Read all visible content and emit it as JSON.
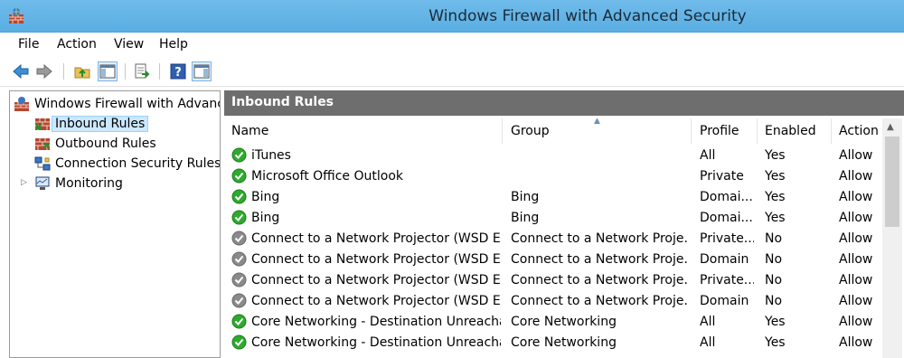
{
  "window": {
    "title": "Windows Firewall with Advanced Security"
  },
  "menu": [
    "File",
    "Action",
    "View",
    "Help"
  ],
  "toolbar": {
    "buttons": [
      "back-arrow-icon",
      "forward-arrow-icon",
      "up-folder-icon",
      "show-hide-tree-icon",
      "export-list-icon",
      "help-icon",
      "show-hide-action-pane-icon"
    ]
  },
  "tree": {
    "root": "Windows Firewall with Advance",
    "items": [
      "Inbound Rules",
      "Outbound Rules",
      "Connection Security Rules",
      "Monitoring"
    ],
    "selected": "Inbound Rules"
  },
  "pane": {
    "title": "Inbound Rules"
  },
  "table": {
    "columns": [
      "Name",
      "Group",
      "Profile",
      "Enabled",
      "Action"
    ],
    "rows": [
      {
        "status": "enabled",
        "name": "iTunes",
        "group": "",
        "profile": "All",
        "enabled": "Yes",
        "action": "Allow"
      },
      {
        "status": "enabled",
        "name": "Microsoft Office Outlook",
        "group": "",
        "profile": "Private",
        "enabled": "Yes",
        "action": "Allow"
      },
      {
        "status": "enabled",
        "name": "Bing",
        "group": "Bing",
        "profile": "Domai...",
        "enabled": "Yes",
        "action": "Allow"
      },
      {
        "status": "enabled",
        "name": "Bing",
        "group": "Bing",
        "profile": "Domai...",
        "enabled": "Yes",
        "action": "Allow"
      },
      {
        "status": "disabled",
        "name": "Connect to a Network Projector (WSD Ev...",
        "group": "Connect to a Network Proje...",
        "profile": "Private...",
        "enabled": "No",
        "action": "Allow"
      },
      {
        "status": "disabled",
        "name": "Connect to a Network Projector (WSD Ev...",
        "group": "Connect to a Network Proje...",
        "profile": "Domain",
        "enabled": "No",
        "action": "Allow"
      },
      {
        "status": "disabled",
        "name": "Connect to a Network Projector (WSD Ev...",
        "group": "Connect to a Network Proje...",
        "profile": "Private...",
        "enabled": "No",
        "action": "Allow"
      },
      {
        "status": "disabled",
        "name": "Connect to a Network Projector (WSD Ev...",
        "group": "Connect to a Network Proje...",
        "profile": "Domain",
        "enabled": "No",
        "action": "Allow"
      },
      {
        "status": "enabled",
        "name": "Core Networking - Destination Unreacha...",
        "group": "Core Networking",
        "profile": "All",
        "enabled": "Yes",
        "action": "Allow"
      },
      {
        "status": "enabled",
        "name": "Core Networking - Destination Unreacha...",
        "group": "Core Networking",
        "profile": "All",
        "enabled": "Yes",
        "action": "Allow"
      }
    ]
  },
  "colors": {
    "titlebar": "#5aaee2",
    "pane_header": "#6e6e6e",
    "enabled_icon": "#2eaa2e",
    "disabled_icon": "#8a8a8a",
    "selection": "#cce8ff"
  }
}
